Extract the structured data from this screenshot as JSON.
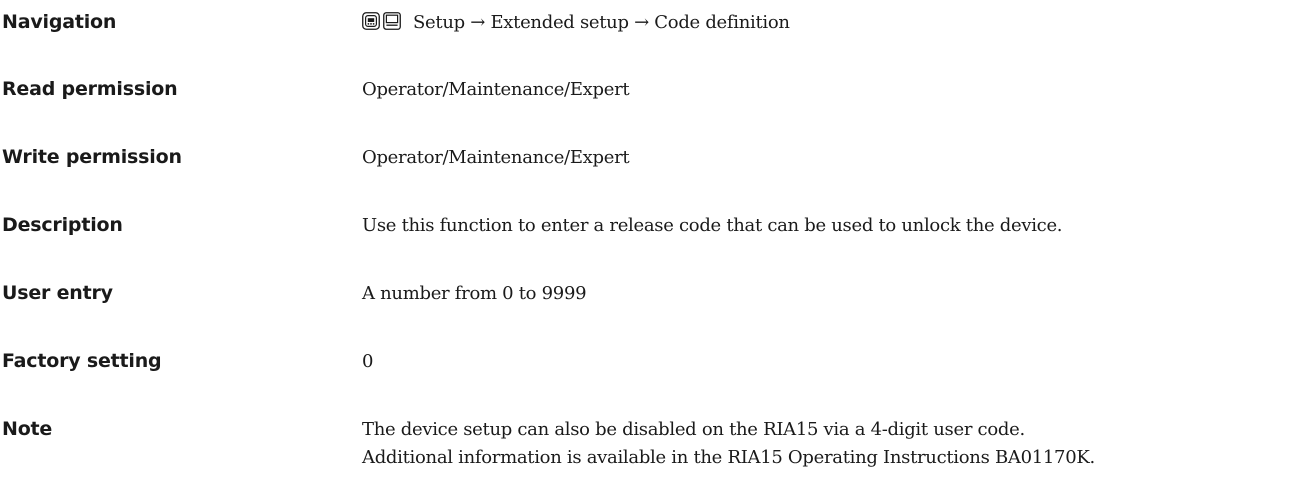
{
  "navigation": {
    "label": "Navigation",
    "icons": [
      "display-operation-icon",
      "menu-icon"
    ],
    "path": "Setup → Extended setup → Code definition"
  },
  "read_permission": {
    "label": "Read permission",
    "value": "Operator/Maintenance/Expert"
  },
  "write_permission": {
    "label": "Write permission",
    "value": "Operator/Maintenance/Expert"
  },
  "description": {
    "label": "Description",
    "value": "Use this function to enter a release code that can be used to unlock the device."
  },
  "user_entry": {
    "label": "User entry",
    "value": "A number from 0 to 9999"
  },
  "factory_setting": {
    "label": "Factory setting",
    "value": "0"
  },
  "note": {
    "label": "Note",
    "lines": [
      "The device setup can also be disabled on the RIA15 via a 4-digit user code.",
      "Additional information is available in the RIA15 Operating Instructions BA01170K."
    ]
  }
}
